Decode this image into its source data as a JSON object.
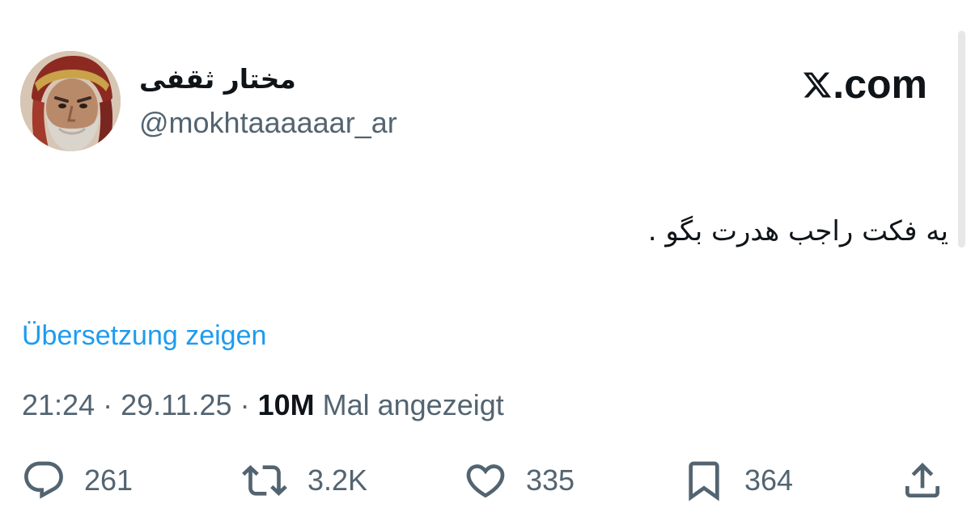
{
  "user": {
    "display_name": "مختار ثقفی",
    "handle": "@mokhtaaaaaar_ar",
    "avatar": "avatar-photo"
  },
  "site_mark": {
    "text": ".com",
    "logo": "x-logo-icon"
  },
  "tweet": {
    "text": "یه فکت راجب هدرت بگو ."
  },
  "translate_link": "Übersetzung zeigen",
  "meta": {
    "time": "21:24",
    "separator_1": " · ",
    "date": "29.11.25",
    "separator_2": " · ",
    "views_count": "10M",
    "views_label": " Mal angezeigt"
  },
  "actions": {
    "replies": {
      "icon": "reply-icon",
      "count": "261"
    },
    "reposts": {
      "icon": "repost-icon",
      "count": "3.2K"
    },
    "likes": {
      "icon": "heart-icon",
      "count": "335"
    },
    "bookmarks": {
      "icon": "bookmark-icon",
      "count": "364"
    },
    "share": {
      "icon": "share-icon"
    }
  },
  "colors": {
    "text_primary": "#0f1419",
    "text_secondary": "#536471",
    "link": "#1d9bf0",
    "background": "#ffffff"
  }
}
